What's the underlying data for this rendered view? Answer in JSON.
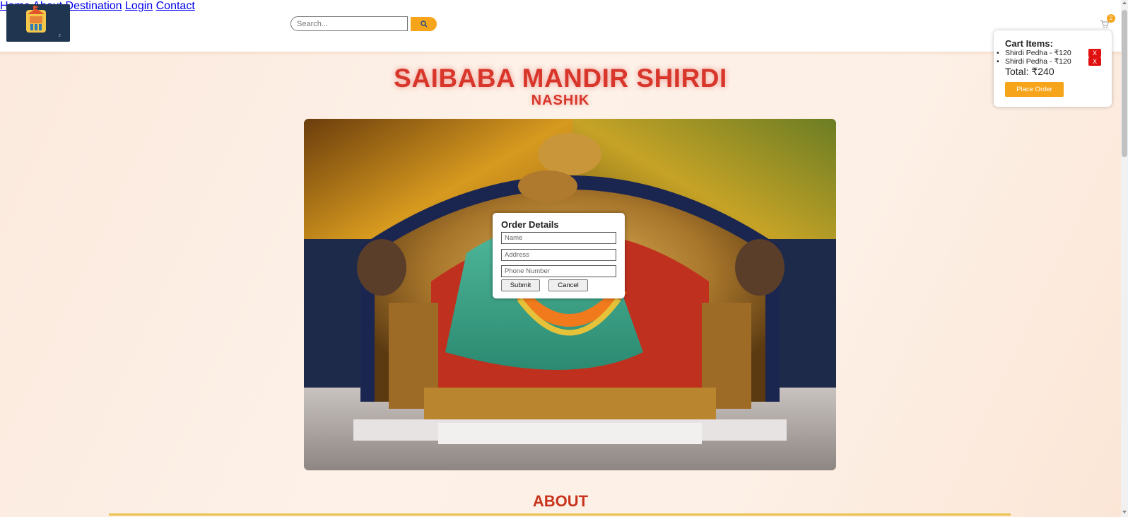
{
  "header": {
    "logo_alt": "logo",
    "search": {
      "placeholder": "Search..."
    },
    "nav": [
      {
        "label": "Home"
      },
      {
        "label": "About"
      },
      {
        "label": "Destination"
      },
      {
        "label": "Login"
      },
      {
        "label": "Contact"
      }
    ],
    "cart_count": "2"
  },
  "cart": {
    "title": "Cart Items:",
    "items": [
      {
        "label": "Shirdi Pedha - ₹120",
        "remove_label": "X"
      },
      {
        "label": "Shirdi Pedha - ₹120",
        "remove_label": "X"
      }
    ],
    "total": "Total: ₹240",
    "place_order_label": "Place Order"
  },
  "hero": {
    "title": "SAIBABA MANDIR SHIRDI",
    "subtitle": "NASHIK"
  },
  "order_modal": {
    "title": "Order Details",
    "name_placeholder": "Name",
    "address_placeholder": "Address",
    "phone_placeholder": "Phone Number",
    "submit_label": "Submit",
    "cancel_label": "Cancel"
  },
  "about": {
    "title": "ABOUT"
  },
  "colors": {
    "accent": "#f6a51b",
    "title_red": "#d9362b",
    "remove_red": "#e01010"
  }
}
